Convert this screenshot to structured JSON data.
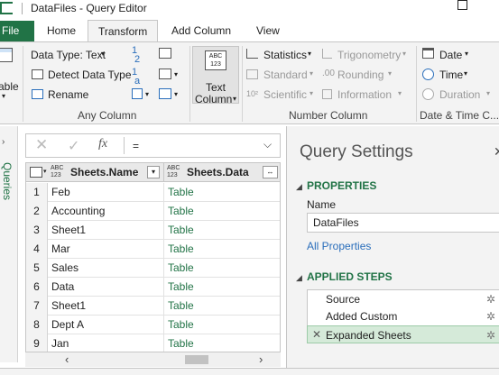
{
  "window": {
    "title": "DataFiles - Query Editor"
  },
  "tabs": {
    "file": "File",
    "home": "Home",
    "transform": "Transform",
    "add_column": "Add Column",
    "view": "View"
  },
  "ribbon": {
    "table_btn": "able",
    "data_type": "Data Type: Text",
    "detect_data_type": "Detect Data Type",
    "rename": "Rename",
    "any_column_group": "Any Column",
    "text_column_1": "Text",
    "text_column_2": "Column",
    "text_column_icon": "ABC 123",
    "statistics": "Statistics",
    "standard": "Standard",
    "scientific": "Scientific",
    "trigonometry": "Trigonometry",
    "rounding": "Rounding",
    "information": "Information",
    "number_column_group": "Number Column",
    "date": "Date",
    "time": "Time",
    "duration": "Duration",
    "date_time_group": "Date & Time C..."
  },
  "formula": {
    "value": "="
  },
  "left_panel": {
    "label": "Queries"
  },
  "grid": {
    "type_badge": "ABC 123",
    "columns": [
      "Sheets.Name",
      "Sheets.Data"
    ],
    "rows": [
      {
        "n": "1",
        "name": "Feb",
        "data": "Table"
      },
      {
        "n": "2",
        "name": "Accounting",
        "data": "Table"
      },
      {
        "n": "3",
        "name": "Sheet1",
        "data": "Table"
      },
      {
        "n": "4",
        "name": "Mar",
        "data": "Table"
      },
      {
        "n": "5",
        "name": "Sales",
        "data": "Table"
      },
      {
        "n": "6",
        "name": "Data",
        "data": "Table"
      },
      {
        "n": "7",
        "name": "Sheet1",
        "data": "Table"
      },
      {
        "n": "8",
        "name": "Dept A",
        "data": "Table"
      },
      {
        "n": "9",
        "name": "Jan",
        "data": "Table"
      }
    ]
  },
  "settings": {
    "title": "Query Settings",
    "properties_header": "PROPERTIES",
    "name_label": "Name",
    "name_value": "DataFiles",
    "all_properties": "All Properties",
    "applied_steps_header": "APPLIED STEPS",
    "steps": [
      "Source",
      "Added Custom",
      "Expanded Sheets"
    ]
  },
  "colors": {
    "accent": "#217346",
    "ribbon_bg": "#f3f3f3",
    "selected_step": "#d5ead9",
    "link": "#2a6ebb"
  }
}
